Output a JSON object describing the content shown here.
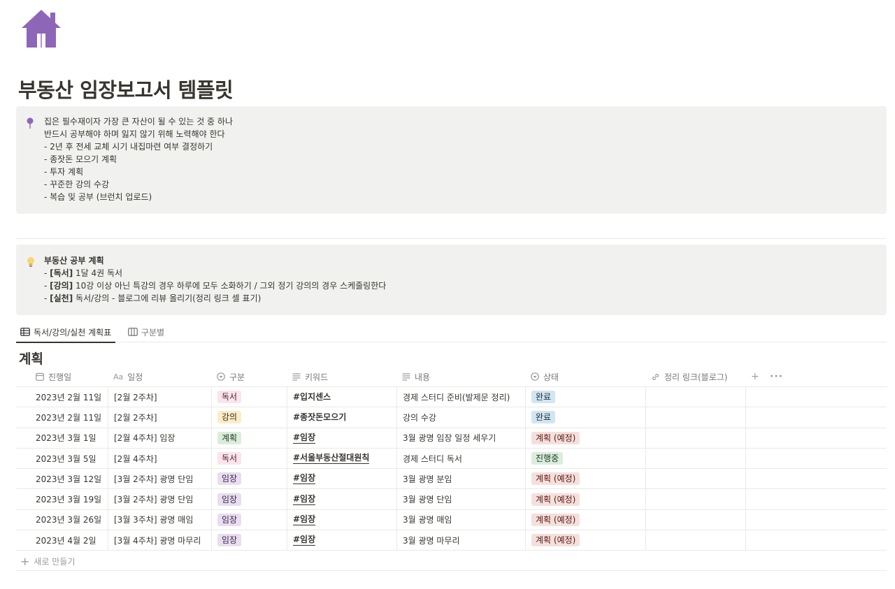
{
  "page": {
    "title": "부동산 임장보고서 템플릿",
    "icon": "house-icon"
  },
  "callout1": {
    "icon": "pushpin-icon",
    "lines": [
      "집은 필수재이자 가장 큰 자산이 될 수 있는 것 중 하나",
      "반드시 공부해야 하며 잃지 않기 위해 노력해야 한다",
      "- 2년 후 전세 교체 시기 내집마련 여부 결정하기",
      "- 종잣돈 모으기 계획",
      "- 투자 계획",
      "- 꾸준한 강의 수강",
      "- 복습 및 공부 (브런치 업로드)"
    ]
  },
  "callout2": {
    "icon": "lightbulb-icon",
    "title": "부동산 공부 계획",
    "items": [
      {
        "prefix": "- ",
        "tag": "[독서]",
        "text": " 1달 4권 독서"
      },
      {
        "prefix": "- ",
        "tag": "[강의]",
        "text": " 10강 이상 아닌 특강의 경우 하루에 모두 소화하기 / 그외 정기 강의의 경우 스케줄링한다"
      },
      {
        "prefix": "- ",
        "tag": "[실천]",
        "text": " 독서/강의 - 블로그에 리뷰 올리기(정리 링크 셀 표기)"
      }
    ]
  },
  "tabs": [
    {
      "label": "독서/강의/실천 계획표",
      "icon": "table-icon",
      "active": true
    },
    {
      "label": "구분별",
      "icon": "board-icon",
      "active": false
    }
  ],
  "database": {
    "title": "계획",
    "columns": [
      {
        "label": "진행일",
        "icon": "calendar-icon"
      },
      {
        "label": "일정",
        "icon": "text-aa-icon"
      },
      {
        "label": "구분",
        "icon": "select-icon"
      },
      {
        "label": "키워드",
        "icon": "lines-icon"
      },
      {
        "label": "내용",
        "icon": "lines-icon"
      },
      {
        "label": "상태",
        "icon": "select-icon"
      },
      {
        "label": "정리 링크(블로그)",
        "icon": "link-icon"
      }
    ],
    "rows": [
      {
        "date": "2023년 2월 11일",
        "schedule_tag": "[2월 2주차]",
        "schedule_text": "",
        "category": "독서",
        "keyword": "#입지센스",
        "content": "경제 스터디 준비(발제문 정리)",
        "status": "완료"
      },
      {
        "date": "2023년 2월 11일",
        "schedule_tag": "[2월 2주차]",
        "schedule_text": "",
        "category": "강의",
        "keyword": "#종잣돈모으기",
        "content": "강의 수강",
        "status": "완료"
      },
      {
        "date": "2023년 3월 1일",
        "schedule_tag": "[2월 4주차]",
        "schedule_text": " 임장",
        "category": "계획",
        "keyword": "#임장",
        "content": "3월 광명 임장 일정 세우기",
        "status": "계획 (예정)"
      },
      {
        "date": "2023년 3월 5일",
        "schedule_tag": "[2월 4주차]",
        "schedule_text": "",
        "category": "독서",
        "keyword": "#서울부동산절대원칙",
        "content": "경제 스터디 독서",
        "status": "진행중"
      },
      {
        "date": "2023년 3월 12일",
        "schedule_tag": "[3월 2주차]",
        "schedule_text": " 광명 단임",
        "category": "임장",
        "keyword": "#임장",
        "content": "3월 광명 분임",
        "status": "계획 (예정)"
      },
      {
        "date": "2023년 3월 19일",
        "schedule_tag": "[3월 2주차]",
        "schedule_text": " 광명 단임",
        "category": "임장",
        "keyword": "#임장",
        "content": "3월 광명 단임",
        "status": "계획 (예정)"
      },
      {
        "date": "2023년 3월 26일",
        "schedule_tag": "[3월 3주차]",
        "schedule_text": " 광명 매임",
        "category": "임장",
        "keyword": "#임장",
        "content": "3월 광명 매임",
        "status": "계획 (예정)"
      },
      {
        "date": "2023년 4월 2일",
        "schedule_tag": "[3월 4주차]",
        "schedule_text": " 광명 마무리",
        "category": "임장",
        "keyword": "#임장",
        "content": "3월 광명 마무리",
        "status": "계획 (예정)"
      }
    ],
    "new_label": "새로 만들기"
  },
  "colors": {
    "category": {
      "독서": {
        "bg": "#fbe4ec",
        "fg": "#4c2337"
      },
      "강의": {
        "bg": "#fdecc8",
        "fg": "#402c1b"
      },
      "계획": {
        "bg": "#dbeddb",
        "fg": "#1c3829"
      },
      "임장": {
        "bg": "#e8deee",
        "fg": "#412454"
      }
    },
    "status": {
      "완료": {
        "bg": "#d3e5ef",
        "fg": "#183347"
      },
      "계획 (예정)": {
        "bg": "#f4e0dc",
        "fg": "#5d1715"
      },
      "진행중": {
        "bg": "#dbeddb",
        "fg": "#1c3829"
      }
    },
    "accent_house": "#8e66b8"
  }
}
